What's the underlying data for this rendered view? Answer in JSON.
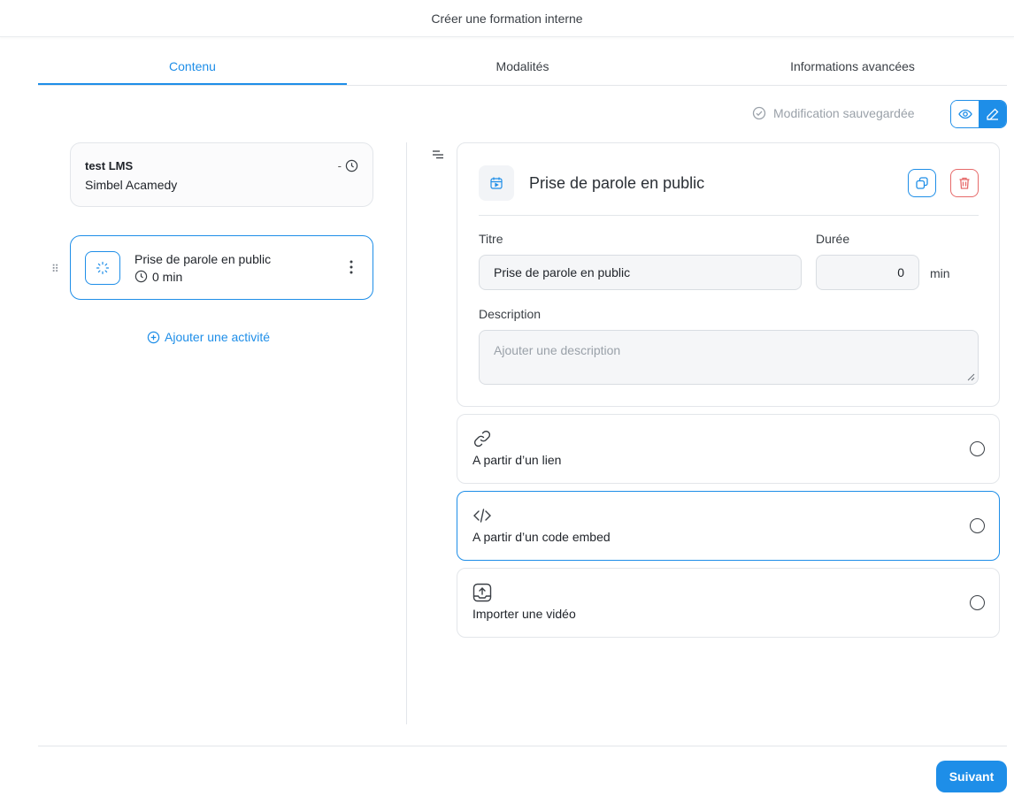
{
  "header": {
    "title": "Créer une formation interne"
  },
  "tabs": [
    {
      "label": "Contenu",
      "active": true
    },
    {
      "label": "Modalités",
      "active": false
    },
    {
      "label": "Informations avancées",
      "active": false
    }
  ],
  "status": {
    "saved_text": "Modification sauvegardée"
  },
  "course": {
    "name": "test LMS",
    "organization": "Simbel Acamedy",
    "duration": "-"
  },
  "activity": {
    "title": "Prise de parole en public",
    "duration": "0 min"
  },
  "add_activity_label": "Ajouter une activité",
  "detail": {
    "title": "Prise de parole en public",
    "title_label": "Titre",
    "title_value": "Prise de parole en public",
    "duration_label": "Durée",
    "duration_value": "0",
    "duration_unit": "min",
    "description_label": "Description",
    "description_placeholder": "Ajouter une description"
  },
  "options": [
    {
      "label": "A partir d’un lien",
      "icon": "link-icon",
      "selected": false
    },
    {
      "label": "A partir d’un code embed",
      "icon": "code-icon",
      "selected": false
    },
    {
      "label": "Importer une vidéo",
      "icon": "upload-icon",
      "selected": false
    }
  ],
  "footer": {
    "next_label": "Suivant"
  },
  "colors": {
    "accent": "#1e8ee8",
    "danger": "#e66a6a",
    "muted": "#9aa1a9"
  }
}
